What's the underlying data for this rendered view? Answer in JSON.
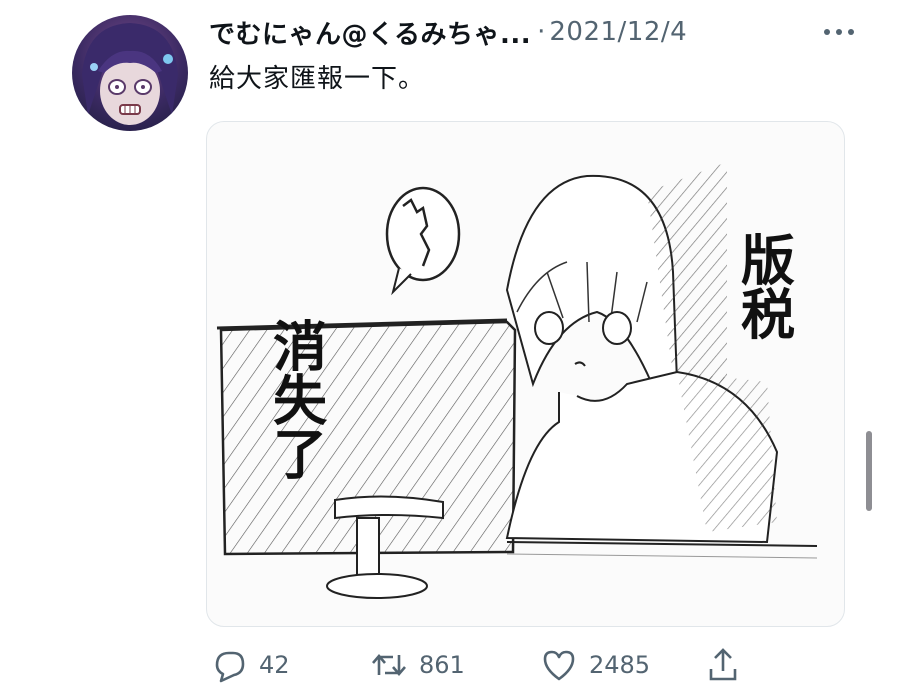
{
  "tweet": {
    "display_name": "でむにゃん@くるみちゃ...",
    "separator": "·",
    "timestamp": "2021/12/4",
    "text": "給大家匯報一下。"
  },
  "media": {
    "caption_right": "版税",
    "caption_left": "消失了"
  },
  "actions": {
    "reply_count": "42",
    "retweet_count": "861",
    "like_count": "2485"
  },
  "icons": {
    "more": "more-horizontal-icon",
    "reply": "reply-bubble-icon",
    "retweet": "retweet-icon",
    "like": "heart-icon",
    "share": "share-icon"
  },
  "colors": {
    "text_primary": "#0f1419",
    "text_secondary": "#536471",
    "scrollbar": "#8e8e93"
  }
}
